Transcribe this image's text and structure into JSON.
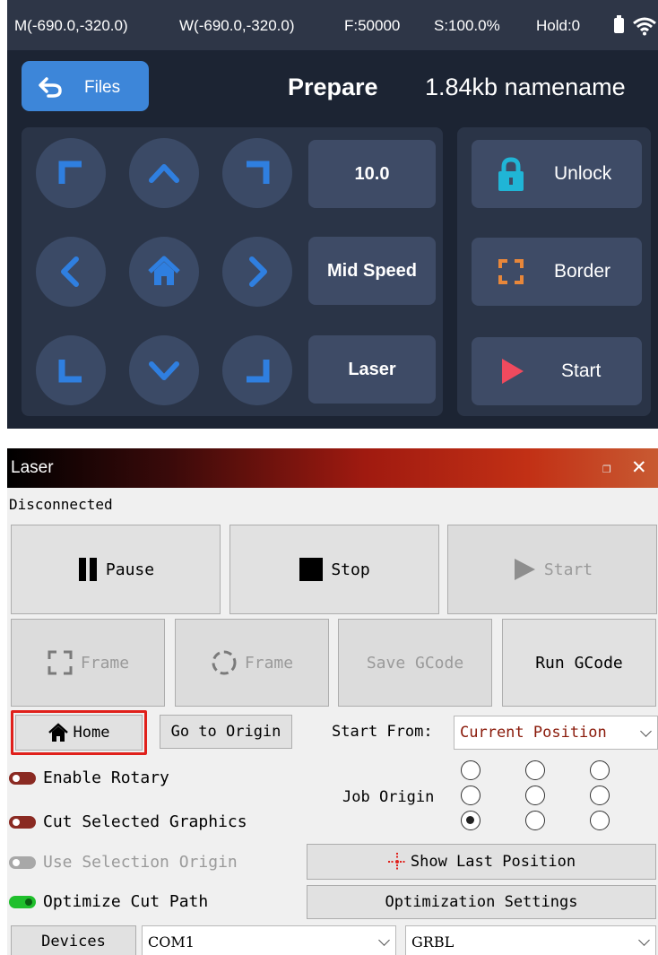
{
  "device": {
    "status": {
      "machine_pos": "M(-690.0,-320.0)",
      "work_pos": "W(-690.0,-320.0)",
      "feed": "F:50000",
      "speed": "S:100.0%",
      "hold": "Hold:0"
    },
    "files_label": "Files",
    "title": "Prepare",
    "file_info": "1.84kb namename",
    "jog_icons": [
      "up-left-icon",
      "up-icon",
      "up-right-icon",
      "left-icon",
      "home-icon",
      "right-icon",
      "down-left-icon",
      "down-icon",
      "down-right-icon"
    ],
    "step_value": "10.0",
    "speed_mode": "Mid Speed",
    "laser_label": "Laser",
    "unlock_label": "Unlock",
    "border_label": "Border",
    "start_label": "Start",
    "colors": {
      "panel": "#1c2433",
      "button": "#3e4b66",
      "accent": "#3d86d9",
      "lock": "#20b5d6",
      "border_icon": "#e8873a",
      "start_icon": "#ef4a5e"
    }
  },
  "laser": {
    "title": "Laser",
    "status": "Disconnected",
    "pause_label": "Pause",
    "stop_label": "Stop",
    "start_label": "Start",
    "frame1_label": "Frame",
    "frame2_label": "Frame",
    "save_gcode_label": "Save GCode",
    "run_gcode_label": "Run GCode",
    "home_label": "Home",
    "go_origin_label": "Go to Origin",
    "start_from_label": "Start From:",
    "start_from_value": "Current Position",
    "job_origin_label": "Job Origin",
    "job_origin_selected": "bottom-left",
    "toggles": [
      {
        "label": "Enable Rotary",
        "state": "off"
      },
      {
        "label": "Cut Selected Graphics",
        "state": "off"
      },
      {
        "label": "Use Selection Origin",
        "state": "disabled"
      },
      {
        "label": "Optimize Cut Path",
        "state": "on"
      }
    ],
    "show_last_position_label": "Show Last Position",
    "optimization_settings_label": "Optimization Settings",
    "devices_label": "Devices",
    "port_value": "COM1",
    "controller_value": "GRBL"
  }
}
